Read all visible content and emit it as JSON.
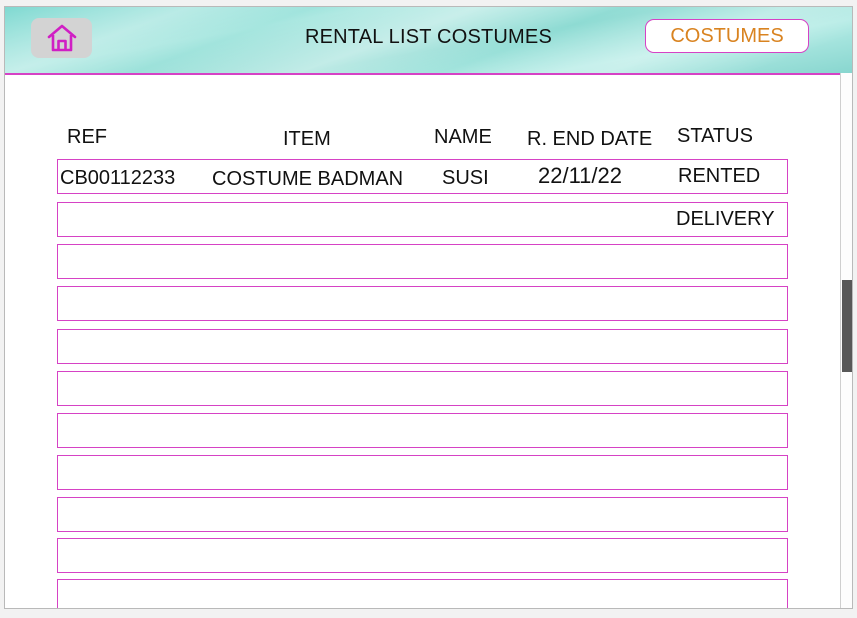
{
  "header": {
    "title": "RENTAL LIST COSTUMES",
    "costumes_button": "COSTUMES",
    "home_icon": "home-icon"
  },
  "table": {
    "columns": [
      "REF",
      "ITEM",
      "NAME",
      "R. END DATE",
      "STATUS"
    ],
    "rows": [
      {
        "ref": "CB00112233",
        "item": "COSTUME BADMAN",
        "name": "SUSI",
        "end_date": "22/11/22",
        "status": "RENTED"
      },
      {
        "ref": "",
        "item": "",
        "name": "",
        "end_date": "",
        "status": "DELIVERY"
      },
      {
        "ref": "",
        "item": "",
        "name": "",
        "end_date": "",
        "status": ""
      },
      {
        "ref": "",
        "item": "",
        "name": "",
        "end_date": "",
        "status": ""
      },
      {
        "ref": "",
        "item": "",
        "name": "",
        "end_date": "",
        "status": ""
      },
      {
        "ref": "",
        "item": "",
        "name": "",
        "end_date": "",
        "status": ""
      },
      {
        "ref": "",
        "item": "",
        "name": "",
        "end_date": "",
        "status": ""
      },
      {
        "ref": "",
        "item": "",
        "name": "",
        "end_date": "",
        "status": ""
      },
      {
        "ref": "",
        "item": "",
        "name": "",
        "end_date": "",
        "status": ""
      },
      {
        "ref": "",
        "item": "",
        "name": "",
        "end_date": "",
        "status": ""
      },
      {
        "ref": "",
        "item": "",
        "name": "",
        "end_date": "",
        "status": ""
      }
    ]
  },
  "colors": {
    "accent_border": "#d642c5",
    "button_text": "#d98320",
    "header_teal": "#8edbd3",
    "home_icon": "#d01fc4"
  }
}
